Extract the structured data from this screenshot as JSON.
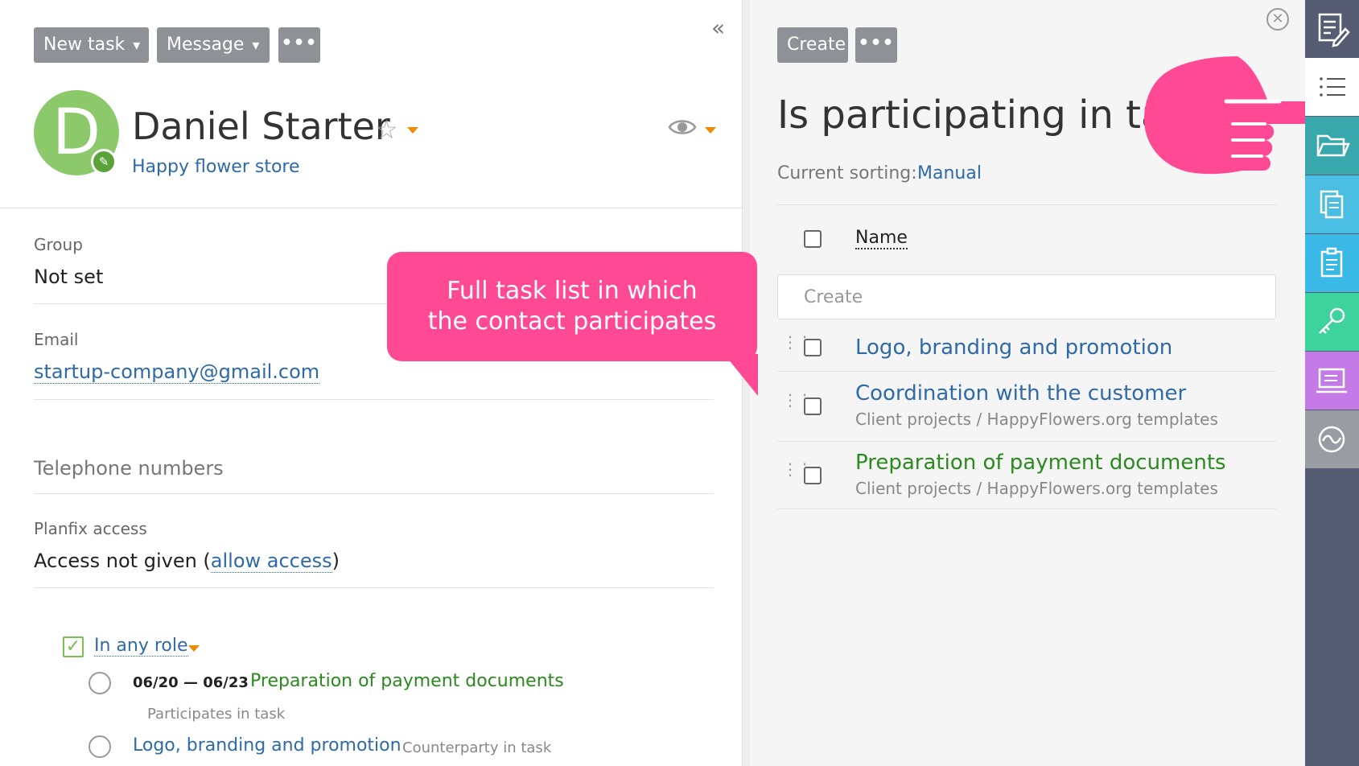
{
  "toolbar": {
    "new_task": "New task",
    "message": "Message",
    "dropdown_arrow": "▾",
    "more": "•••"
  },
  "contact": {
    "initial": "D",
    "name": "Daniel Starter",
    "company": "Happy flower store"
  },
  "fields": {
    "group_label": "Group",
    "group_value": "Not set",
    "email_label": "Email",
    "email_value": "startup-company@gmail.com",
    "phone_label": "Telephone numbers",
    "access_label": "Planfix access",
    "access_prefix": "Access not given (",
    "access_link": "allow access",
    "access_suffix": ")"
  },
  "left_tasks": {
    "role_filter": "In any role",
    "items": [
      {
        "dates": "06/20 — 06/23",
        "title": "Preparation of payment documents",
        "role": "Participates in task",
        "title_color": "#2a8a1e"
      },
      {
        "dates": "",
        "title": "Logo, branding and promotion",
        "role": "Counterparty in task",
        "title_color": "#2f6aa8"
      }
    ]
  },
  "callout": {
    "line1": "Full task list in which",
    "line2": "the contact participates"
  },
  "panel": {
    "create_button": "Create",
    "more": "•••",
    "title": "Is participating in task",
    "sorting_label": "Current sorting:",
    "sorting_value": "Manual",
    "name_column": "Name",
    "create_placeholder": "Create",
    "tasks": [
      {
        "title": "Logo, branding and promotion",
        "path": "",
        "color": "#2f6aa8"
      },
      {
        "title": "Coordination with the customer",
        "path": "Client projects / HappyFlowers.org templates",
        "color": "#2f6aa8"
      },
      {
        "title": "Preparation of payment documents",
        "path": "Client projects / HappyFlowers.org templates",
        "color": "#2a8a1e"
      }
    ]
  },
  "sidebar": {
    "items": [
      {
        "icon": "edit-note-icon",
        "color": "#565d73"
      },
      {
        "icon": "list-icon",
        "color": "#ffffff"
      },
      {
        "icon": "folder-icon",
        "color": "#39a8ad"
      },
      {
        "icon": "documents-icon",
        "color": "#49bde2"
      },
      {
        "icon": "clipboard-icon",
        "color": "#3ab9e6"
      },
      {
        "icon": "key-icon",
        "color": "#3ed39c"
      },
      {
        "icon": "handbook-icon",
        "color": "#c47be6"
      },
      {
        "icon": "analytics-icon",
        "color": "#9a9ca3"
      }
    ]
  },
  "colors": {
    "accent_pink": "#ff4994",
    "link_blue": "#2f6aa8",
    "green": "#2a8a1e",
    "orange_caret": "#f18a00"
  }
}
